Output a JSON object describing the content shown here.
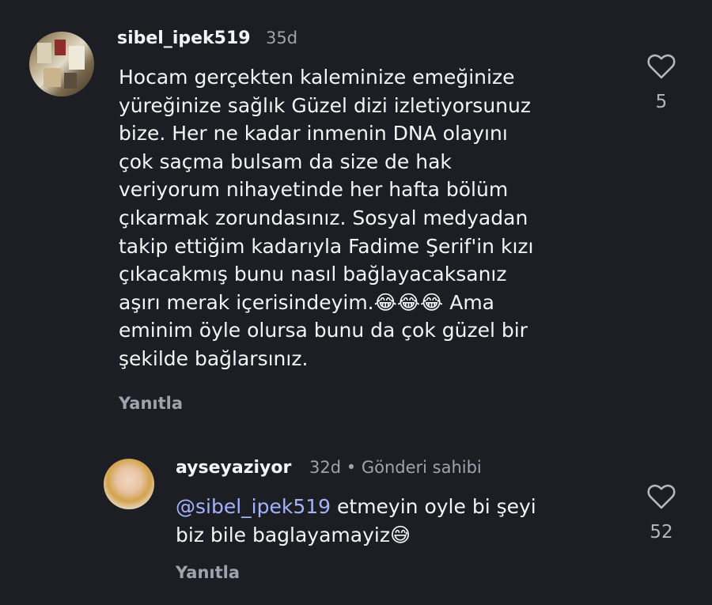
{
  "comments": [
    {
      "username": "sibel_ipek519",
      "time": "35d",
      "text": "Hocam gerçekten kaleminize emeğinize\nyüreğinize sağlık Güzel dizi izletiyorsunuz\nbize. Her ne kadar inmenin DNA olayını\nçok saçma bulsam da size de hak\nveriyorum nihayetinde her hafta bölüm\nçıkarmak zorundasınız. Sosyal medyadan\ntakip ettiğim kadarıyla Fadime Şerif'in kızı\nçıkacakmış bunu nasıl bağlayacaksanız\naşırı merak içerisindeyim.",
      "emoji_tail": "😂😂😂",
      "text_tail": " Ama\neminim öyle olursa bunu da çok güzel bir\nşekilde bağlarsınız.",
      "reply_label": "Yanıtla",
      "likes": "5"
    },
    {
      "username": "ayseyaziyor",
      "time": "32d",
      "separator": "•",
      "author_badge": "Gönderi sahibi",
      "mention": "@sibel_ipek519",
      "text": " etmeyin oyle bi şeyi\nbiz bile baglayamayiz",
      "emoji_tail": "😅",
      "reply_label": "Yanıtla",
      "likes": "52"
    }
  ]
}
